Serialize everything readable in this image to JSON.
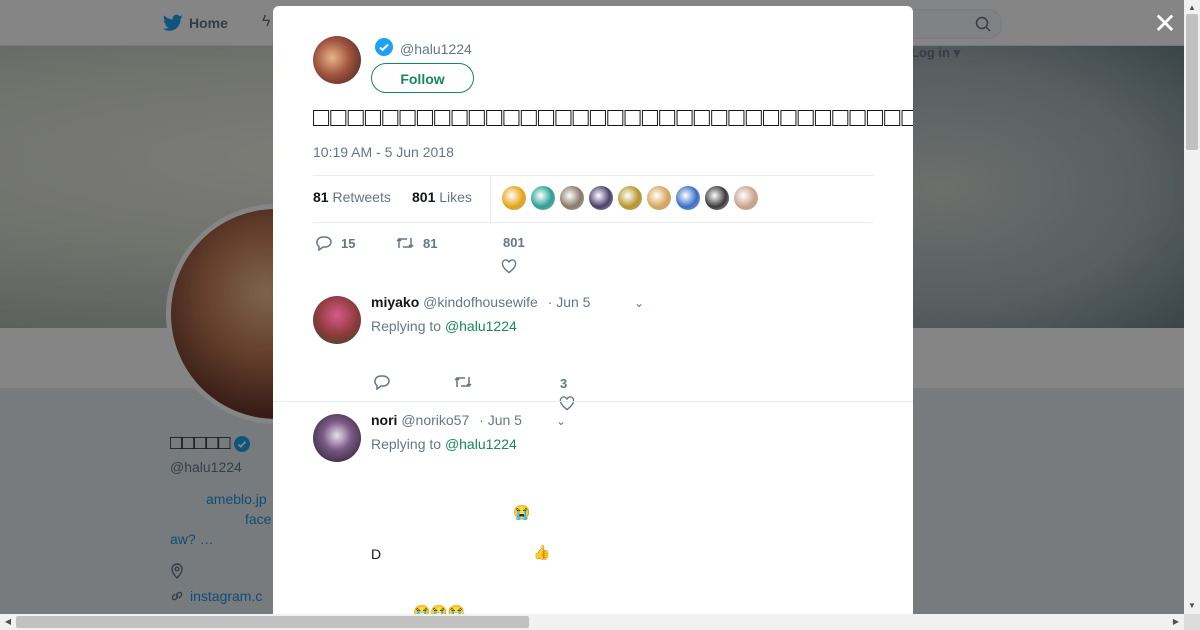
{
  "nav": {
    "home_label": "Home",
    "login_label": "Log in"
  },
  "profile": {
    "name": "□□□□□",
    "handle": "@halu1224",
    "bio_lines": [
      "ameblo.jp",
      "face",
      "aw?        …"
    ],
    "link": "instagram.c"
  },
  "tweet": {
    "handle": "@halu1224",
    "follow_label": "Follow",
    "text": "□□□□□□□□□□□□□□□□□□□□□□□□□□□□□□□□□□□□□□□□□□□□□□",
    "timestamp": "10:19 AM - 5 Jun 2018",
    "retweets_count": "81",
    "retweets_label": "Retweets",
    "likes_count": "801",
    "likes_label": "Likes",
    "likers_colors": [
      "#e8a317",
      "#2aa198",
      "#8a7a6a",
      "#4a3f6b",
      "#b8972e",
      "#d9a55a",
      "#3b6fc9",
      "#3d3a3a",
      "#c9a48d"
    ],
    "actions": {
      "replies": "15",
      "retweets": "81",
      "likes": "801"
    }
  },
  "replies": [
    {
      "name": "miyako",
      "handle": "@kindofhousewife",
      "date": "· Jun 5",
      "replying_prefix": "Replying to",
      "replying_to": "@halu1224",
      "likes": "3",
      "avatar_color": "#8b3a3a"
    },
    {
      "name": "nori",
      "handle": "@noriko57",
      "date": "· Jun 5",
      "replying_prefix": "Replying to",
      "replying_to": "@halu1224",
      "body": {
        "line1": "😭",
        "line2_prefix": "D",
        "line2_emoji": "👍",
        "line3": "😭😭😭"
      },
      "avatar_color": "#3a2e40"
    }
  ],
  "colors": {
    "accent": "#17885b",
    "twitter_blue": "#1da1f2",
    "verified": "#1da1f2"
  }
}
